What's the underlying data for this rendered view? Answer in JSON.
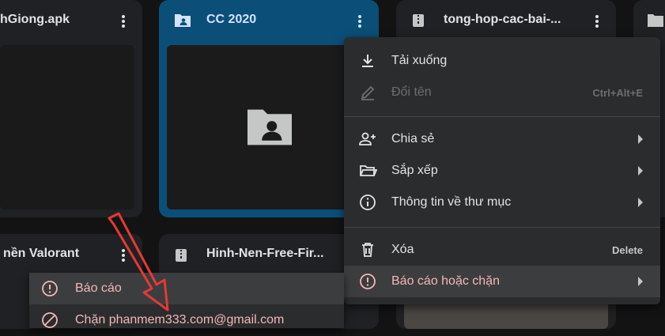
{
  "files": [
    {
      "name": "hGiong.apk",
      "icon": "more-vert-icon"
    },
    {
      "name": "CC 2020",
      "icon": "shared-folder-icon"
    },
    {
      "name": "tong-hop-cac-bai-...",
      "icon": "zip-file-icon"
    },
    {
      "name": "nền Valorant",
      "icon": "more-vert-icon"
    },
    {
      "name": "Hinh-Nen-Free-Fir...",
      "icon": "zip-file-icon"
    }
  ],
  "context_menu": {
    "download": {
      "label": "Tải xuống",
      "icon": "download-icon"
    },
    "rename": {
      "label": "Đổi tên",
      "shortcut": "Ctrl+Alt+E",
      "icon": "edit-icon"
    },
    "share": {
      "label": "Chia sẻ",
      "icon": "person-add-icon"
    },
    "organize": {
      "label": "Sắp xếp",
      "icon": "folder-open-icon"
    },
    "info": {
      "label": "Thông tin về thư mục",
      "icon": "info-icon"
    },
    "delete": {
      "label": "Xóa",
      "shortcut": "Delete",
      "icon": "trash-icon"
    },
    "report_block": {
      "label": "Báo cáo hoặc chặn",
      "icon": "report-icon"
    }
  },
  "submenu": {
    "report": {
      "label": "Báo cáo",
      "icon": "report-icon"
    },
    "block": {
      "label": "Chặn phanmem333.com@gmail.com",
      "icon": "block-icon"
    }
  },
  "colors": {
    "selected_card": "#0b4f78",
    "report_text": "#f2b8b5",
    "arrow_annotation": "#e53935"
  }
}
